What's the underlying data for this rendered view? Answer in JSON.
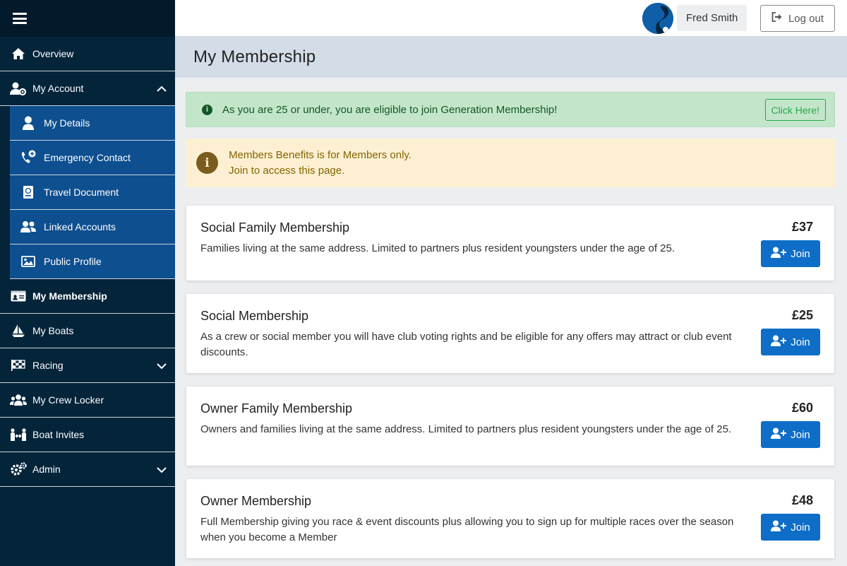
{
  "sidebar": {
    "items": [
      {
        "label": "Overview",
        "icon": "home-icon"
      },
      {
        "label": "My Account",
        "icon": "user-gear-icon",
        "expanded": true,
        "children": [
          {
            "label": "My Details",
            "icon": "user-icon"
          },
          {
            "label": "Emergency Contact",
            "icon": "phone-plus-icon"
          },
          {
            "label": "Travel Document",
            "icon": "passport-icon"
          },
          {
            "label": "Linked Accounts",
            "icon": "users-icon"
          },
          {
            "label": "Public Profile",
            "icon": "image-icon"
          }
        ]
      },
      {
        "label": "My Membership",
        "icon": "id-card-icon",
        "active": true
      },
      {
        "label": "My Boats",
        "icon": "sailboat-icon"
      },
      {
        "label": "Racing",
        "icon": "checkered-flag-icon"
      },
      {
        "label": "My Crew Locker",
        "icon": "group-icon"
      },
      {
        "label": "Boat Invites",
        "icon": "invite-icon"
      },
      {
        "label": "Admin",
        "icon": "gears-icon"
      }
    ]
  },
  "header": {
    "user_name": "Fred Smith",
    "logout_label": "Log out"
  },
  "page": {
    "title": "My Membership"
  },
  "alerts": {
    "green": {
      "text": "As you are 25 or under, you are eligible to join Generation Membership!",
      "button": "Click Here!"
    },
    "yellow": {
      "line1": "Members Benefits is for Members only.",
      "line2": "Join to access this page."
    }
  },
  "memberships": [
    {
      "title": "Social Family Membership",
      "description": "Families living at the same address. Limited to partners plus resident youngsters under the age of 25.",
      "price": "£37",
      "button": "Join"
    },
    {
      "title": "Social Membership",
      "description": "As a crew or social member you will have club voting rights and be eligible for any offers may attract or club event discounts.",
      "price": "£25",
      "button": "Join"
    },
    {
      "title": "Owner Family Membership",
      "description": "Owners and families living at the same address. Limited to partners plus resident youngsters under the age of 25.",
      "price": "£60",
      "button": "Join"
    },
    {
      "title": "Owner Membership",
      "description": "Full Membership giving you race & event discounts plus allowing you to sign up for multiple races over the season when you become a Member",
      "price": "£48",
      "button": "Join"
    }
  ],
  "colors": {
    "sidebar_bg": "#04243a",
    "submenu_bg": "#0e4f8f",
    "primary_button": "#0e6ec7",
    "success_alert": "#c3e6cb",
    "warning_alert": "#fdf0d2"
  }
}
